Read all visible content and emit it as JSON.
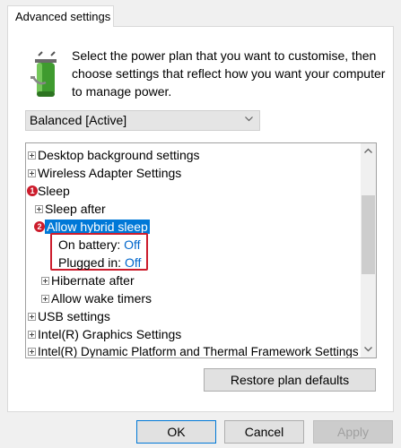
{
  "tab": {
    "label": "Advanced settings"
  },
  "description": "Select the power plan that you want to customise, then choose settings that reflect how you want your computer to manage power.",
  "plan_select": {
    "value": "Balanced [Active]"
  },
  "tree": {
    "desktop_bg": "Desktop background settings",
    "wireless": "Wireless Adapter Settings",
    "sleep_badge": "1",
    "sleep": "Sleep",
    "sleep_after": "Sleep after",
    "hybrid_badge": "2",
    "hybrid": "Allow hybrid sleep",
    "on_battery_label": "On battery:",
    "on_battery_value": "Off",
    "plugged_in_label": "Plugged in:",
    "plugged_in_value": "Off",
    "hibernate": "Hibernate after",
    "wake_timers": "Allow wake timers",
    "usb": "USB settings",
    "intel_graphics": "Intel(R) Graphics Settings",
    "intel_dptf": "Intel(R) Dynamic Platform and Thermal Framework Settings"
  },
  "buttons": {
    "restore": "Restore plan defaults",
    "ok": "OK",
    "cancel": "Cancel",
    "apply": "Apply"
  },
  "colors": {
    "selection": "#0078d7",
    "value_link": "#0066cc",
    "annotation_red": "#cc1c2c"
  },
  "icons": [
    "battery-plug-icon",
    "chevron-down-icon",
    "expand-plus-icon",
    "scroll-up-arrow-icon",
    "scroll-down-arrow-icon"
  ]
}
